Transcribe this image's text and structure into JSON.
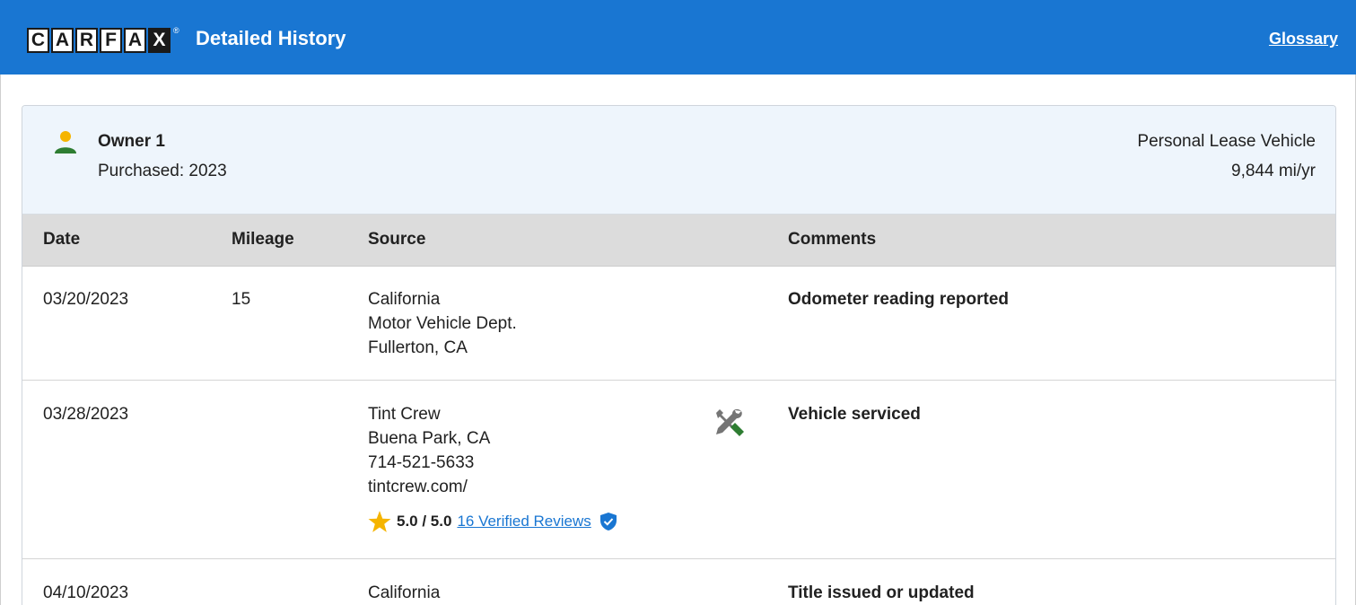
{
  "header": {
    "logo_letters": [
      "C",
      "A",
      "R",
      "F",
      "A",
      "X"
    ],
    "registered_mark": "®",
    "title": "Detailed History",
    "glossary_link": "Glossary",
    "bar_color": "#1976d2"
  },
  "owner": {
    "icon": "person-icon",
    "title": "Owner 1",
    "purchased": "Purchased: 2023",
    "vehicle_type": "Personal Lease Vehicle",
    "miles_per_year": "9,844 mi/yr"
  },
  "table": {
    "columns": [
      "Date",
      "Mileage",
      "Source",
      "Comments"
    ],
    "rows": [
      {
        "date": "03/20/2023",
        "mileage": "15",
        "source": [
          "California",
          "Motor Vehicle Dept.",
          "Fullerton, CA"
        ],
        "comment": "Odometer reading reported"
      },
      {
        "date": "03/28/2023",
        "mileage": "",
        "source": [
          "Tint Crew",
          "Buena Park, CA",
          "714-521-5633",
          "tintcrew.com/"
        ],
        "comment": "Vehicle serviced",
        "service_icon": "wrench-screwdriver-icon",
        "rating": {
          "score": "5.0 / 5.0",
          "reviews_link": "16 Verified Reviews",
          "star_icon": "star-icon",
          "verified_icon": "verified-shield-icon",
          "star_color": "#f5b400",
          "link_color": "#1976d2"
        }
      },
      {
        "date": "04/10/2023",
        "mileage": "",
        "source": [
          "California"
        ],
        "comment": "Title issued or updated"
      }
    ]
  }
}
